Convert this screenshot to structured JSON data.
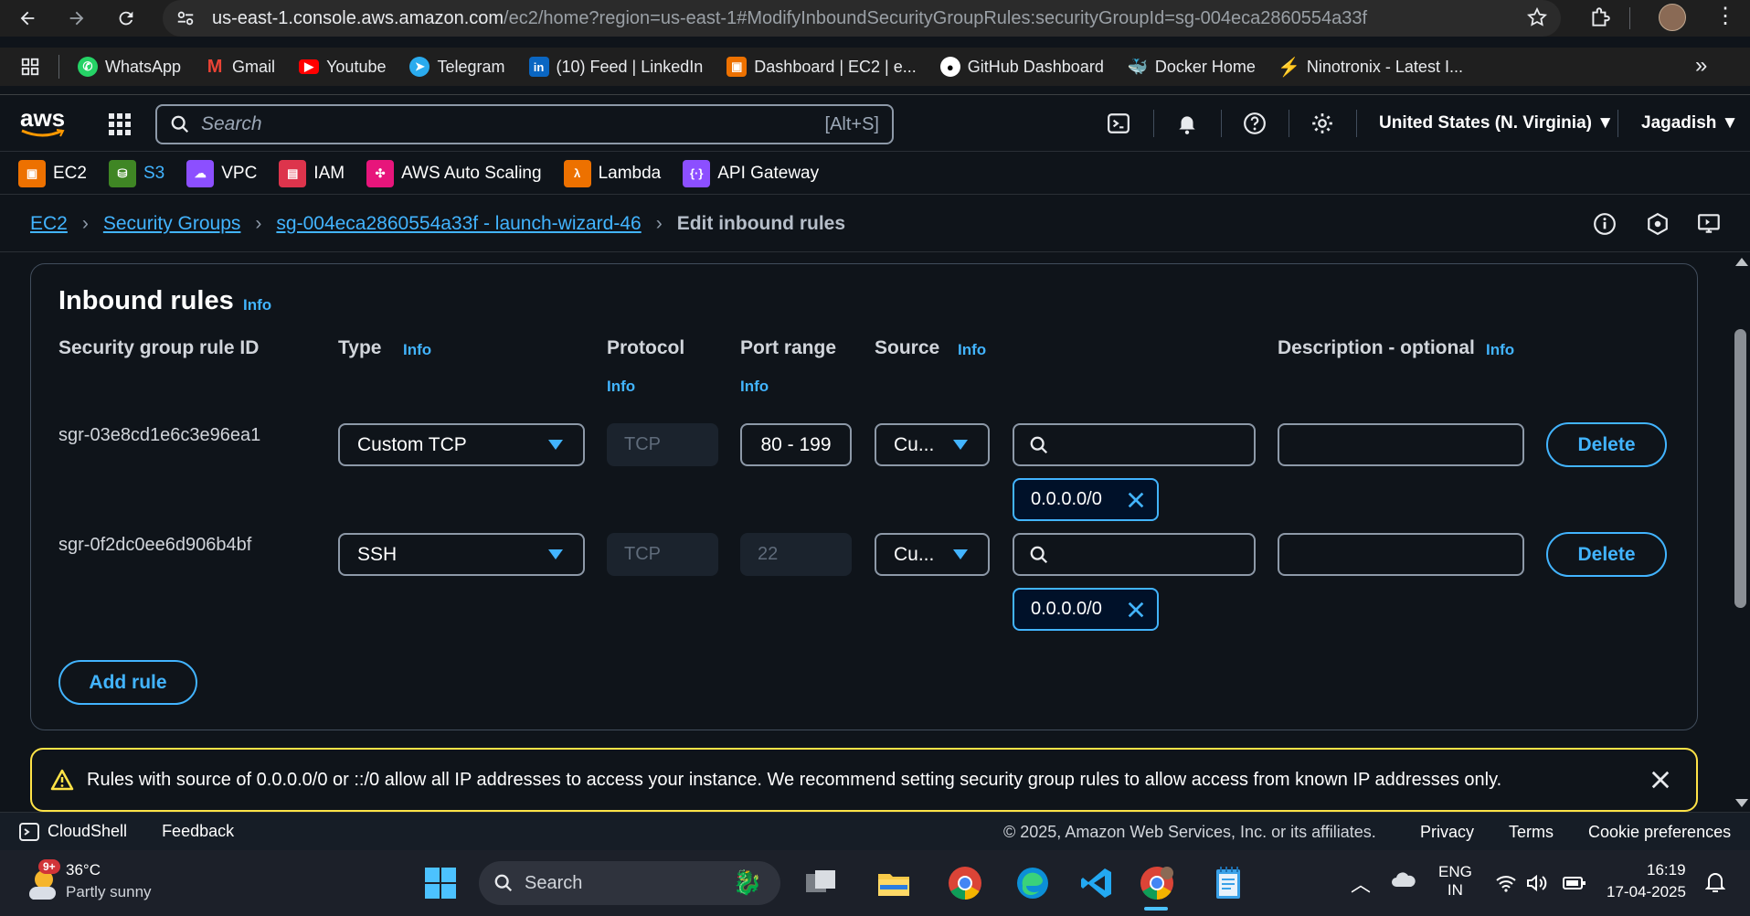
{
  "browser": {
    "url_host": "us-east-1.console.aws.amazon.com",
    "url_path": "/ec2/home?region=us-east-1#ModifyInboundSecurityGroupRules:securityGroupId=sg-004eca2860554a33f",
    "bookmarks": [
      {
        "label": "WhatsApp",
        "icon": "whatsapp-icon",
        "color": "#25d366"
      },
      {
        "label": "Gmail",
        "icon": "gmail-icon",
        "color": "#ea4335"
      },
      {
        "label": "Youtube",
        "icon": "youtube-icon",
        "color": "#ff0000"
      },
      {
        "label": "Telegram",
        "icon": "telegram-icon",
        "color": "#2aabee"
      },
      {
        "label": "(10) Feed | LinkedIn",
        "icon": "linkedin-icon",
        "color": "#0a66c2"
      },
      {
        "label": "Dashboard | EC2 | e...",
        "icon": "ec2-icon",
        "color": "#ed7100"
      },
      {
        "label": "GitHub Dashboard",
        "icon": "github-icon",
        "color": "#ffffff"
      },
      {
        "label": "Docker Home",
        "icon": "docker-icon",
        "color": "#1d63ed"
      },
      {
        "label": "Ninotronix - Latest I...",
        "icon": "ninotronix-icon",
        "color": "#7b3fe4"
      }
    ],
    "more_label": "»"
  },
  "aws_header": {
    "logo": "aws",
    "search_placeholder": "Search",
    "search_hint": "[Alt+S]",
    "region": "United States (N. Virginia) ▼",
    "user": "Jagadish ▼"
  },
  "services": [
    {
      "label": "EC2",
      "color": "#ed7100",
      "icon": "ec2-icon"
    },
    {
      "label": "S3",
      "color": "#3f8624",
      "icon": "s3-icon",
      "link": true
    },
    {
      "label": "VPC",
      "color": "#8c4fff",
      "icon": "vpc-icon"
    },
    {
      "label": "IAM",
      "color": "#dd344c",
      "icon": "iam-icon"
    },
    {
      "label": "AWS Auto Scaling",
      "color": "#e7157b",
      "icon": "auto-scaling-icon"
    },
    {
      "label": "Lambda",
      "color": "#ed7100",
      "icon": "lambda-icon"
    },
    {
      "label": "API Gateway",
      "color": "#8c4fff",
      "icon": "api-gateway-icon"
    }
  ],
  "breadcrumb": {
    "items": [
      "EC2",
      "Security Groups",
      "sg-004eca2860554a33f - launch-wizard-46"
    ],
    "current": "Edit inbound rules"
  },
  "panel": {
    "title": "Inbound rules",
    "info": "Info",
    "columns": {
      "rule_id": "Security group rule ID",
      "type": "Type",
      "protocol": "Protocol",
      "port_range": "Port range",
      "source": "Source",
      "description": "Description - optional"
    },
    "rules": [
      {
        "id": "sgr-03e8cd1e6c3e96ea1",
        "type": "Custom TCP",
        "protocol": "TCP",
        "port_range": "80 - 199",
        "source_type": "Cu...",
        "source_token": "0.0.0.0/0",
        "description": "",
        "delete": "Delete"
      },
      {
        "id": "sgr-0f2dc0ee6d906b4bf",
        "type": "SSH",
        "protocol": "TCP",
        "port_range": "22",
        "source_type": "Cu...",
        "source_token": "0.0.0.0/0",
        "description": "",
        "delete": "Delete"
      }
    ],
    "add_rule": "Add rule"
  },
  "warning": {
    "text": "Rules with source of 0.0.0.0/0 or ::/0 allow all IP addresses to access your instance. We recommend setting security group rules to allow access from known IP addresses only.",
    "color": "#ffe347"
  },
  "footer": {
    "cloudshell": "CloudShell",
    "feedback": "Feedback",
    "copyright": "© 2025, Amazon Web Services, Inc. or its affiliates.",
    "privacy": "Privacy",
    "terms": "Terms",
    "cookies": "Cookie preferences"
  },
  "taskbar": {
    "weather_temp": "36°C",
    "weather_desc": "Partly sunny",
    "weather_badge": "9+",
    "search": "Search",
    "lang_top": "ENG",
    "lang_bottom": "IN",
    "time": "16:19",
    "date": "17-04-2025"
  }
}
